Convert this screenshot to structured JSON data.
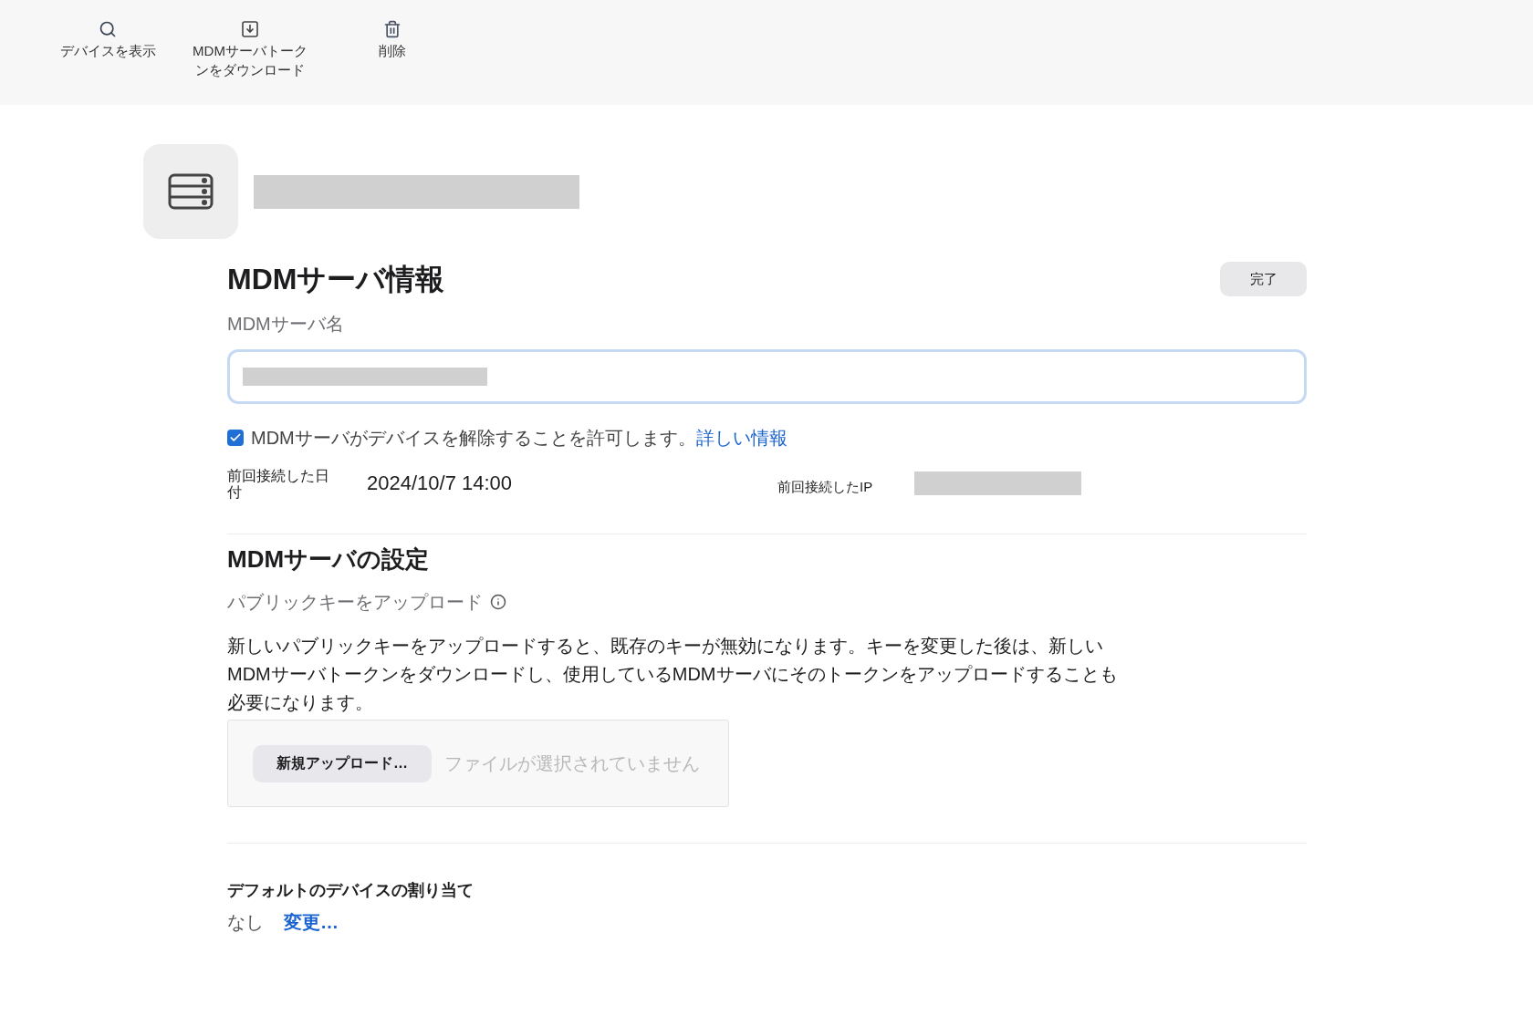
{
  "toolbar": [
    {
      "kind": "search",
      "label": "デバイスを表示"
    },
    {
      "kind": "download",
      "label": "MDMサーバトークンをダウンロード"
    },
    {
      "kind": "trash",
      "label": "削除"
    }
  ],
  "info": {
    "title": "MDMサーバ情報",
    "done_button": "完了",
    "name_label": "MDMサーバ名",
    "allow_release": {
      "checked": true,
      "text": "MDMサーバがデバイスを解除することを許可します。",
      "link": "詳しい情報"
    },
    "last_date_label": "前回接続した日付",
    "last_date": "2024/10/7 14:00",
    "last_ip_label": "前回接続したIP"
  },
  "settings": {
    "title": "MDMサーバの設定",
    "upload_label": "パブリックキーをアップロード",
    "description": "新しいパブリックキーをアップロードすると、既存のキーが無効になります。キーを変更した後は、新しいMDMサーバトークンをダウンロードし、使用しているMDMサーバにそのトークンをアップロードすることも必要になります。",
    "upload_button": "新規アップロード…",
    "no_file": "ファイルが選択されていません"
  },
  "default_assignment": {
    "title": "デフォルトのデバイスの割り当て",
    "value": "なし",
    "change_link": "変更…"
  }
}
